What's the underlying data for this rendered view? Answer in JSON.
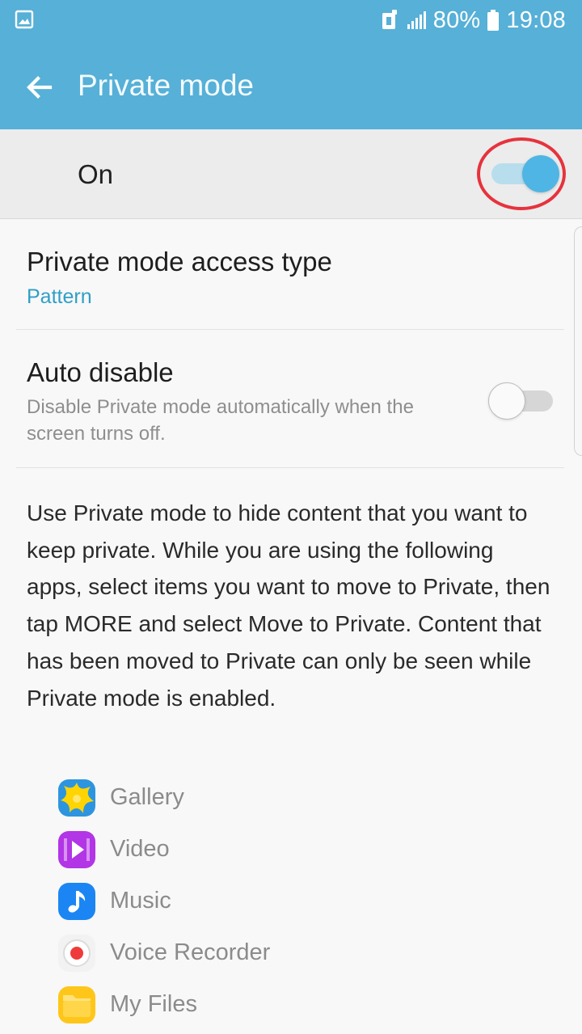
{
  "status_bar": {
    "battery": "80%",
    "time": "19:08",
    "icons": [
      "gallery-notification-icon",
      "nfc-icon",
      "signal-icon",
      "battery-icon"
    ]
  },
  "app_bar": {
    "title": "Private mode",
    "back_icon": "arrow-left-icon"
  },
  "master_switch": {
    "label": "On",
    "state": "on"
  },
  "settings": {
    "access_type": {
      "title": "Private mode access type",
      "value": "Pattern"
    },
    "auto_disable": {
      "title": "Auto disable",
      "summary": "Disable Private mode automatically when the screen turns off.",
      "state": "off"
    }
  },
  "description": "Use Private mode to hide content that you want to keep private. While you are using the following apps, select items you want to move to Private, then tap MORE and select Move to Private. Content that has been moved to Private can only be seen while Private mode is enabled.",
  "apps": [
    {
      "label": "Gallery",
      "icon": "gallery-icon"
    },
    {
      "label": "Video",
      "icon": "video-icon"
    },
    {
      "label": "Music",
      "icon": "music-icon"
    },
    {
      "label": "Voice Recorder",
      "icon": "voice-recorder-icon"
    },
    {
      "label": "My Files",
      "icon": "my-files-icon"
    }
  ],
  "colors": {
    "accent": "#56b0d7",
    "value_text": "#2f9fc6",
    "annotation": "#e6333d"
  }
}
